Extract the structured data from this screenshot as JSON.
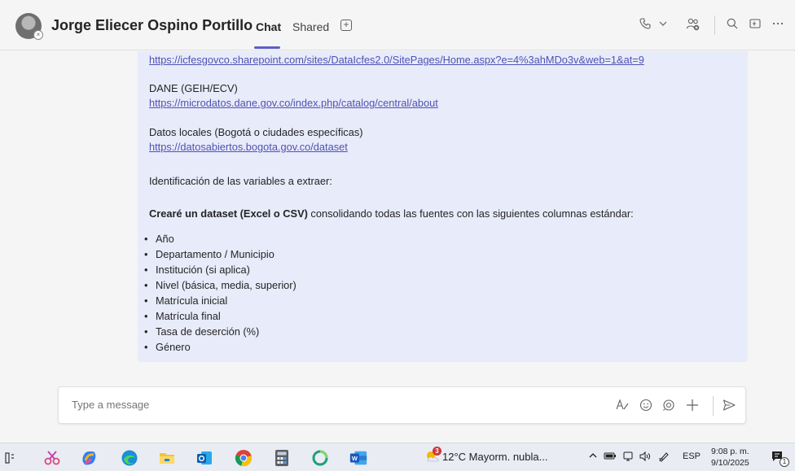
{
  "header": {
    "contact_name": "Jorge Eliecer Ospino Portillo",
    "tabs": [
      {
        "label": "Chat"
      },
      {
        "label": "Shared"
      }
    ],
    "add_tab_icon": "plus-square-icon",
    "icons": [
      "phone-icon",
      "chevron-down-icon",
      "people-add-icon",
      "search-icon",
      "popout-icon",
      "more-icon"
    ]
  },
  "message": {
    "link1": "https://icfesgovco.sharepoint.com/sites/DataIcfes2.0/SitePages/Home.aspx?e=4%3ahMDo3v&web=1&at=9",
    "dane_label": "DANE (GEIH/ECV)",
    "link2": "https://microdatos.dane.gov.co/index.php/catalog/central/about",
    "local_label": "Datos locales (Bogotá o ciudades específicas)",
    "link3": "https://datosabiertos.bogota.gov.co/dataset",
    "identification": "Identificación de las variables a extraer:",
    "dataset_bold": "Crearé un dataset (Excel o CSV)",
    "dataset_rest": " consolidando todas las fuentes con las siguientes columnas estándar:",
    "columns": [
      "Año",
      "Departamento / Municipio",
      "Institución (si aplica)",
      "Nivel (básica, media, superior)",
      "Matrícula inicial",
      "Matrícula final",
      "Tasa de deserción (%)",
      "Género"
    ]
  },
  "composer": {
    "placeholder": "Type a message"
  },
  "taskbar": {
    "weather_badge": "3",
    "weather": "12°C  Mayorm. nubla...",
    "language": "ESP",
    "time": "9:08 p. m.",
    "date": "9/10/2025",
    "notification_count": "1"
  },
  "colors": {
    "accent": "#5b5fc7",
    "bubble": "#e8ebfa",
    "link": "#4f52b2",
    "background": "#f5f5f5"
  }
}
